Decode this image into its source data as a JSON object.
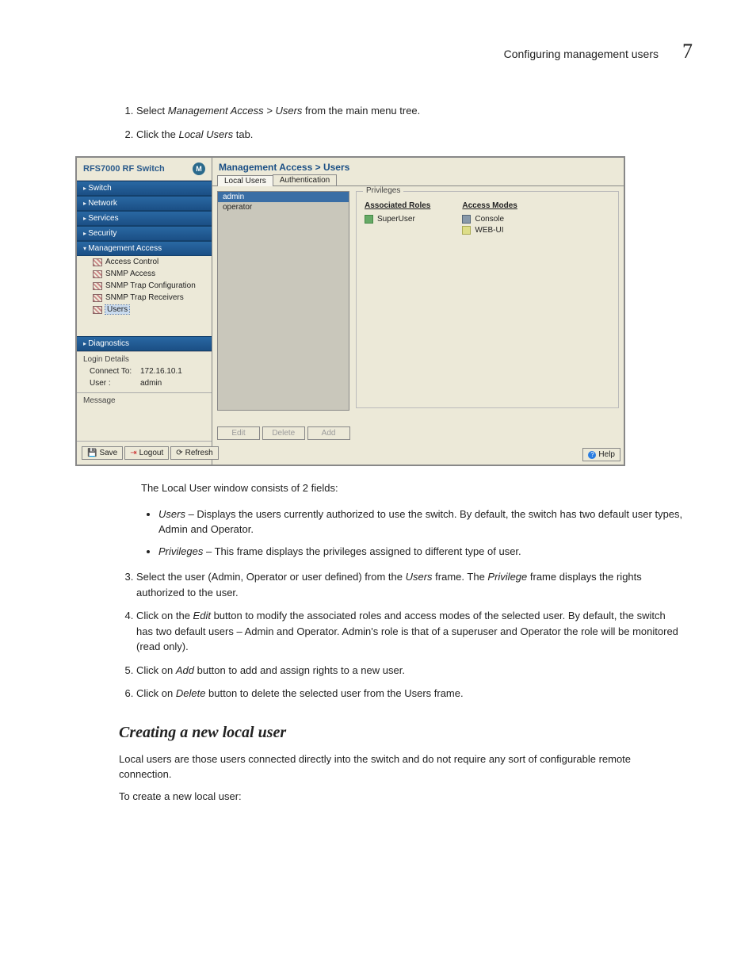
{
  "page_header": {
    "title": "Configuring management users",
    "number": "7"
  },
  "step1_a": "Select ",
  "step1_b": "Management Access > Users",
  "step1_c": " from the main menu tree.",
  "step2_a": "Click the ",
  "step2_b": "Local Users",
  "step2_c": " tab.",
  "below_img": "The Local User window consists of 2 fields:",
  "bul1_a": "Users",
  "bul1_b": " – Displays the users currently authorized to use the switch. By default, the switch has two default user types, Admin and Operator.",
  "bul2_a": "Privileges",
  "bul2_b": " – This frame displays the privileges assigned to different type of user.",
  "step3_a": "Select the user (Admin, Operator or user defined) from the ",
  "step3_b": "Users",
  "step3_c": " frame. The ",
  "step3_d": "Privilege",
  "step3_e": " frame displays the rights authorized to the user.",
  "step4_a": "Click on the ",
  "step4_b": "Edit",
  "step4_c": " button to modify the associated roles and access modes of the selected user. By default, the switch has two default users – Admin and Operator. Admin's role is that of a superuser and Operator the role will be monitored (read only).",
  "step5_a": "Click on ",
  "step5_b": "Add",
  "step5_c": " button to add and assign rights to a new user.",
  "step6_a": "Click on ",
  "step6_b": "Delete",
  "step6_c": " button to delete the selected user from the Users frame.",
  "sect_heading": "Creating a new local user",
  "sect_p1": "Local users are those users connected directly into the switch and do not require any sort of configurable remote connection.",
  "sect_p2": "To create a new local user:",
  "app": {
    "title_a": "RFS",
    "title_b": "7000",
    "title_c": " RF Switch",
    "logo": "M",
    "nav": {
      "switch": "Switch",
      "network": "Network",
      "services": "Services",
      "security": "Security",
      "mgmt": "Management Access",
      "sub_access": "Access Control",
      "sub_snmp_access": "SNMP Access",
      "sub_snmp_trap_conf": "SNMP Trap Configuration",
      "sub_snmp_trap_recv": "SNMP Trap Receivers",
      "sub_users": "Users",
      "diag": "Diagnostics"
    },
    "login_details": {
      "label": "Login Details",
      "connect_lbl": "Connect To:",
      "connect_val": "172.16.10.1",
      "user_lbl": "User :",
      "user_val": "admin"
    },
    "message_label": "Message",
    "footer": {
      "save": "Save",
      "logout": "Logout",
      "refresh": "Refresh"
    },
    "breadcrumb": "Management Access > Users",
    "tabs": {
      "local": "Local Users",
      "auth": "Authentication"
    },
    "users": {
      "admin": "admin",
      "operator": "operator"
    },
    "priv": {
      "label": "Privileges",
      "roles_h": "Associated Roles",
      "role1": "SuperUser",
      "modes_h": "Access Modes",
      "mode1": "Console",
      "mode2": "WEB-UI"
    },
    "actions": {
      "edit": "Edit",
      "delete": "Delete",
      "add": "Add"
    },
    "help": "Help"
  }
}
